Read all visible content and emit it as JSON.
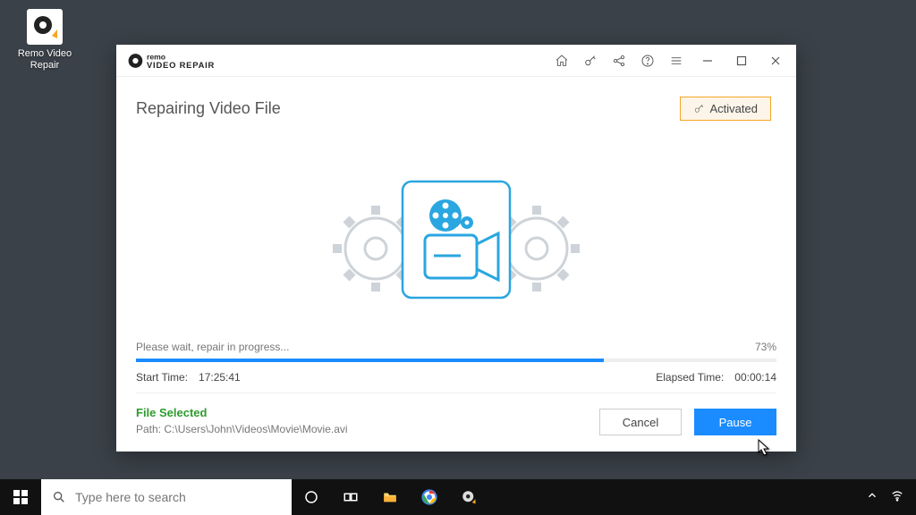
{
  "desktop_icon": {
    "label": "Remo Video\nRepair"
  },
  "brand": {
    "line1": "remo",
    "line2": "VIDEO REPAIR"
  },
  "header": {
    "title": "Repairing Video File",
    "activated_label": "Activated"
  },
  "progress": {
    "wait_text": "Please wait, repair in progress...",
    "percent_label": "73%",
    "percent_value": 73,
    "start_label": "Start Time:",
    "start_value": "17:25:41",
    "elapsed_label": "Elapsed Time:",
    "elapsed_value": "00:00:14"
  },
  "file": {
    "selected_label": "File Selected",
    "path_prefix": "Path: ",
    "path_value": "C:\\Users\\John\\Videos\\Movie\\Movie.avi"
  },
  "buttons": {
    "cancel": "Cancel",
    "pause": "Pause"
  },
  "taskbar": {
    "search_placeholder": "Type here to search"
  }
}
